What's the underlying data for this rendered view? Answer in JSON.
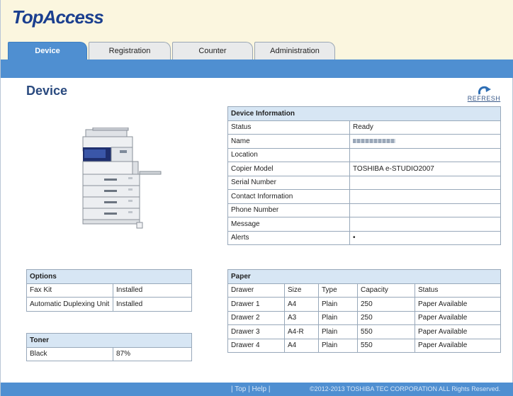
{
  "app": {
    "logo": "TopAccess"
  },
  "tabs": [
    {
      "label": "Device",
      "active": true
    },
    {
      "label": "Registration",
      "active": false
    },
    {
      "label": "Counter",
      "active": false
    },
    {
      "label": "Administration",
      "active": false
    }
  ],
  "page": {
    "title": "Device",
    "refresh_label": "REFRESH"
  },
  "device_info": {
    "header": "Device Information",
    "rows": [
      {
        "label": "Status",
        "value": "Ready"
      },
      {
        "label": "Name",
        "value": ""
      },
      {
        "label": "Location",
        "value": ""
      },
      {
        "label": "Copier Model",
        "value": "TOSHIBA e-STUDIO2007"
      },
      {
        "label": "Serial Number",
        "value": ""
      },
      {
        "label": "Contact Information",
        "value": ""
      },
      {
        "label": "Phone Number",
        "value": ""
      },
      {
        "label": "Message",
        "value": ""
      },
      {
        "label": "Alerts",
        "value": "•"
      }
    ]
  },
  "options": {
    "header": "Options",
    "rows": [
      {
        "label": "Fax Kit",
        "value": "Installed"
      },
      {
        "label": "Automatic Duplexing Unit",
        "value": "Installed"
      }
    ]
  },
  "toner": {
    "header": "Toner",
    "rows": [
      {
        "label": "Black",
        "value": "87%"
      }
    ]
  },
  "paper": {
    "header": "Paper",
    "columns": [
      "Drawer",
      "Size",
      "Type",
      "Capacity",
      "Status"
    ],
    "rows": [
      [
        "Drawer 1",
        "A4",
        "Plain",
        "250",
        "Paper Available"
      ],
      [
        "Drawer 2",
        "A3",
        "Plain",
        "250",
        "Paper Available"
      ],
      [
        "Drawer 3",
        "A4-R",
        "Plain",
        "550",
        "Paper Available"
      ],
      [
        "Drawer 4",
        "A4",
        "Plain",
        "550",
        "Paper Available"
      ]
    ]
  },
  "footer": {
    "top_link": "Top",
    "help_link": "Help",
    "copyright": "©2012-2013 TOSHIBA TEC CORPORATION ALL Rights Reserved."
  },
  "colors": {
    "brand_blue": "#4f8fd1",
    "table_header": "#d7e6f4",
    "logo": "#1b3f8f"
  }
}
